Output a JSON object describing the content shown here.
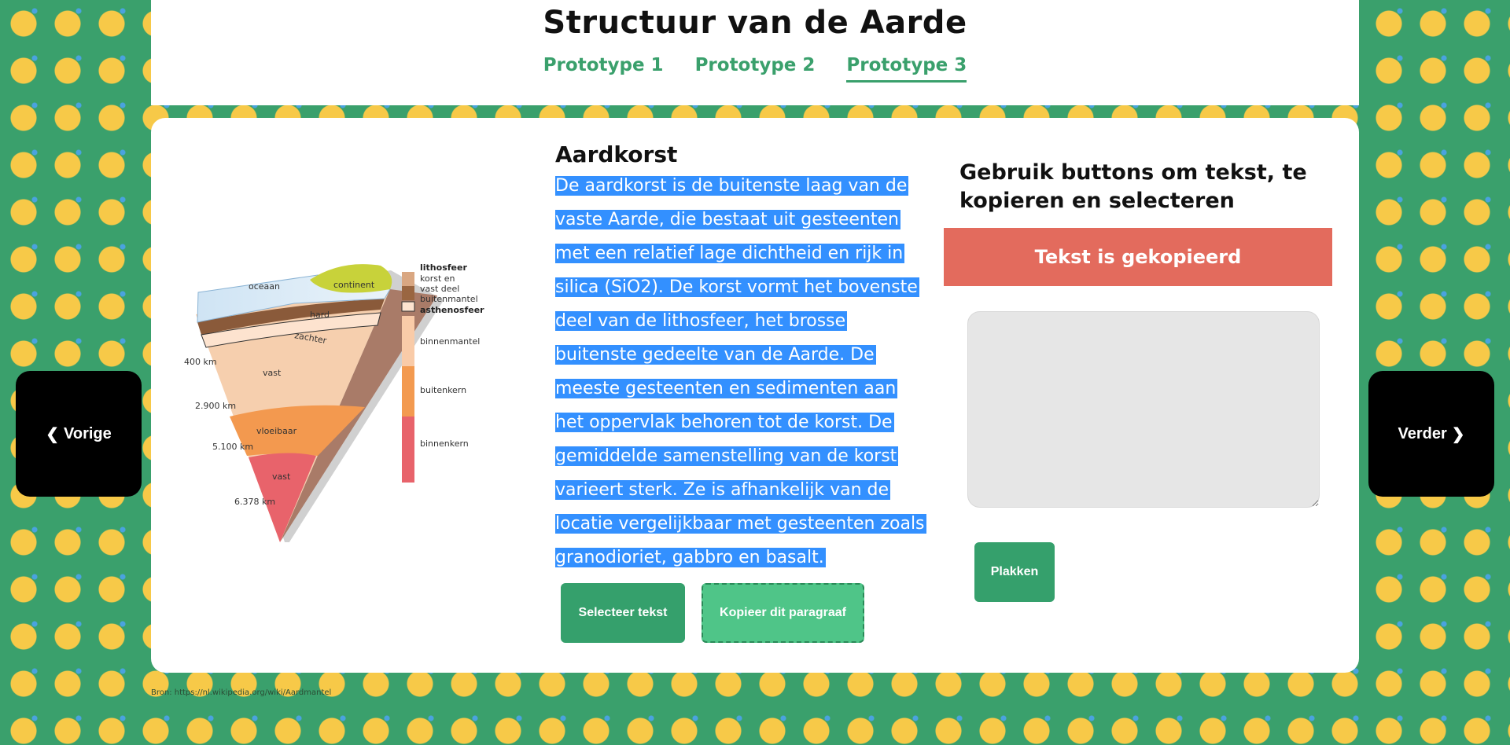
{
  "page": {
    "title": "Structuur van de Aarde",
    "tabs": [
      "Prototype 1",
      "Prototype 2",
      "Prototype 3"
    ],
    "active_tab": "Prototype 3"
  },
  "diagram": {
    "legend": [
      "lithosfeer",
      "korst en",
      "vast deel",
      "buitenmantel",
      "asthenosfeer",
      "binnenmantel",
      "buitenkern",
      "binnenkern"
    ],
    "layer_labels": [
      "oceaan",
      "continent",
      "hard",
      "zachter",
      "vast",
      "vloeibaar",
      "vast"
    ],
    "depths": [
      "400 km",
      "2.900 km",
      "5.100 km",
      "6.378 km"
    ]
  },
  "content": {
    "heading": "Aardkorst",
    "paragraph": "De aardkorst is de buitenste laag van de vaste Aarde, die bestaat uit gesteenten met een relatief lage dichtheid en rijk in silica (SiO2). De korst vormt het bovenste deel van de lithosfeer, het brosse buitenste gedeelte van de Aarde. De meeste gesteenten en sedimenten aan het oppervlak behoren tot de korst. De gemiddelde samenstelling van de korst varieert sterk. Ze is afhankelijk van de locatie vergelijkbaar met gesteenten zoals granodioriet, gabbro en basalt."
  },
  "buttons": {
    "select": "Selecteer tekst",
    "copy": "Kopieer dit paragraaf",
    "paste": "Plakken",
    "prev": "Vorige",
    "next": "Verder"
  },
  "helper": {
    "title": "Gebruik buttons om tekst, te kopieren en selecteren",
    "toast": "Tekst is gekopieerd",
    "paste_value": ""
  },
  "source": "Bron: https://nl.wikipedia.org/wiki/Aardmantel",
  "colors": {
    "background": "#3aa06c",
    "accent": "#35a06c",
    "selection": "#3390ff",
    "toast": "#e36b5d"
  }
}
